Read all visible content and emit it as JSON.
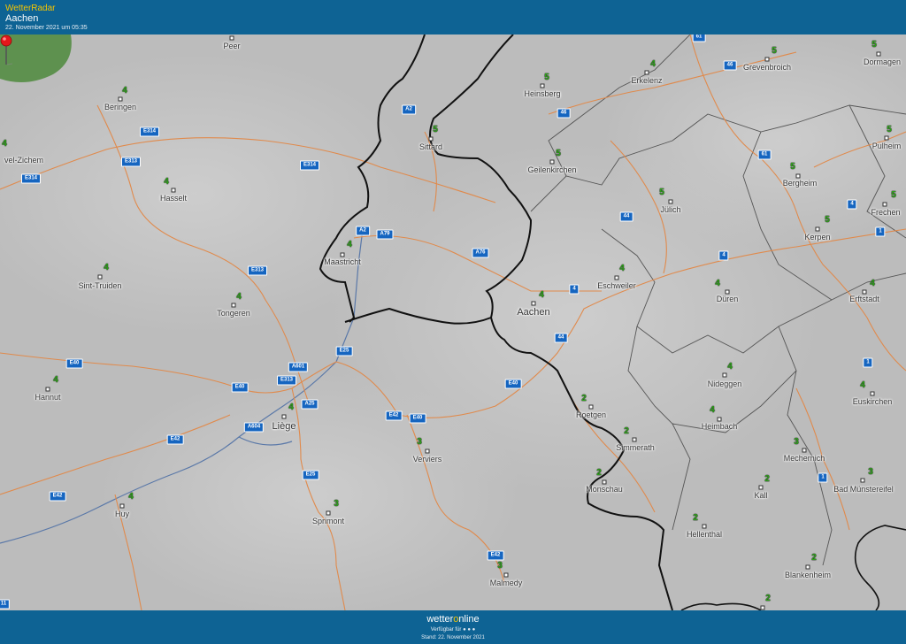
{
  "header": {
    "app_name": "WetterRadar",
    "location": "Aachen",
    "timestamp": "22. November 2021 um 05:35"
  },
  "footer": {
    "brand_pre": "wetter",
    "brand_o": "o",
    "brand_post": "nline",
    "availability": "Verfügbar für ● ● ●",
    "stand": "Stand: 22. November 2021"
  },
  "colors": {
    "header_bg": "#0e6394",
    "road": "#e08a4c",
    "national_border": "#111111",
    "region_border": "#555555",
    "river": "#5a78a8",
    "temperature": "#2ea31a",
    "road_shield": "#1565c0",
    "marker": "#e3171b"
  },
  "marker": {
    "icon": "map-pin-icon"
  },
  "cities": [
    {
      "name": "Peer",
      "temp": ""
    },
    {
      "name": "Beringen",
      "temp": "4"
    },
    {
      "name": "Hasselt",
      "temp": "4"
    },
    {
      "name": "vel-Zichem",
      "temp": "4"
    },
    {
      "name": "Sint-Truiden",
      "temp": "4"
    },
    {
      "name": "Tongeren",
      "temp": "4"
    },
    {
      "name": "Hannut",
      "temp": "4"
    },
    {
      "name": "Huy",
      "temp": "4"
    },
    {
      "name": "Liège",
      "temp": "4"
    },
    {
      "name": "Maastricht",
      "temp": "4"
    },
    {
      "name": "Sittard",
      "temp": "5"
    },
    {
      "name": "Heinsberg",
      "temp": "5"
    },
    {
      "name": "Erkelenz",
      "temp": "4"
    },
    {
      "name": "Geilenkirchen",
      "temp": "5"
    },
    {
      "name": "Grevenbroich",
      "temp": "5"
    },
    {
      "name": "Dormagen",
      "temp": "5"
    },
    {
      "name": "Pulheim",
      "temp": "5"
    },
    {
      "name": "Frechen",
      "temp": "5"
    },
    {
      "name": "Bergheim",
      "temp": "5"
    },
    {
      "name": "Jülich",
      "temp": "5"
    },
    {
      "name": "Kerpen",
      "temp": "5"
    },
    {
      "name": "Eschweiler",
      "temp": "4"
    },
    {
      "name": "Aachen",
      "temp": "4"
    },
    {
      "name": "Düren",
      "temp": "4"
    },
    {
      "name": "Erftstadt",
      "temp": "4"
    },
    {
      "name": "Nideggen",
      "temp": "4"
    },
    {
      "name": "Euskirchen",
      "temp": "4"
    },
    {
      "name": "Roetgen",
      "temp": "2"
    },
    {
      "name": "Heimbach",
      "temp": "4"
    },
    {
      "name": "Simmerath",
      "temp": "2"
    },
    {
      "name": "Mechernich",
      "temp": "3"
    },
    {
      "name": "Monschau",
      "temp": "2"
    },
    {
      "name": "Kall",
      "temp": "2"
    },
    {
      "name": "Bad Münstereifel",
      "temp": "3"
    },
    {
      "name": "Verviers",
      "temp": "3"
    },
    {
      "name": "Sprimont",
      "temp": "3"
    },
    {
      "name": "Hellenthal",
      "temp": "2"
    },
    {
      "name": "Blankenheim",
      "temp": "2"
    },
    {
      "name": "Malmedy",
      "temp": "3"
    },
    {
      "name": "",
      "temp": "2"
    }
  ],
  "roads": [
    "61",
    "46",
    "A2",
    "46",
    "E314",
    "E313",
    "E314",
    "E314",
    "A2",
    "A79",
    "61",
    "44",
    "4",
    "A76",
    "E313",
    "4",
    "1",
    "4",
    "44",
    "E40",
    "A601",
    "E25",
    "E40",
    "E313",
    "A25",
    "E40",
    "E42",
    "A604",
    "E42",
    "E40",
    "1",
    "E25",
    "E42",
    "1",
    "E42",
    "11"
  ]
}
